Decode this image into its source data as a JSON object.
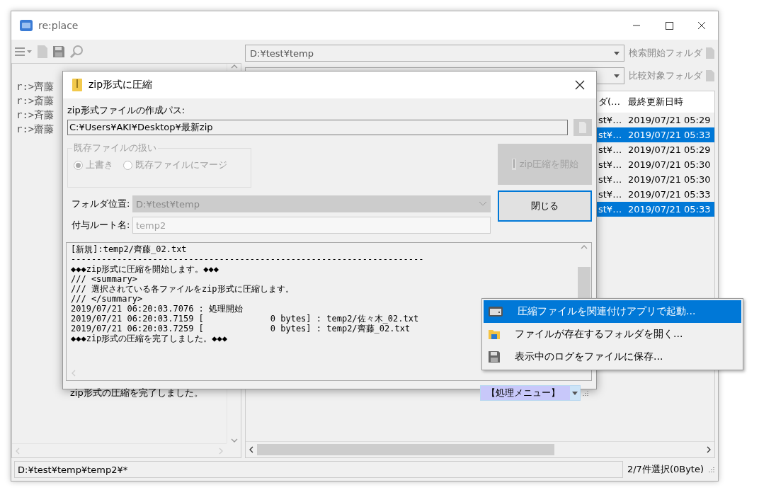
{
  "window": {
    "title": "re:place"
  },
  "left_pane": {
    "lines": [
      "r:>齊藤",
      "r:>斎藤",
      "r:>斉藤",
      "r:>齋藤"
    ]
  },
  "folders": [
    {
      "value": "D:¥test¥temp",
      "button": "検索開始フォルダ"
    },
    {
      "button": "比較対象フォルダ"
    }
  ],
  "table": {
    "columns": [
      "ダ(…",
      "最終更新日時"
    ],
    "rows": [
      {
        "cells": [
          "st¥…",
          "2019/07/21 05:29"
        ],
        "selected": false
      },
      {
        "cells": [
          "st¥…",
          "2019/07/21 05:33"
        ],
        "selected": true
      },
      {
        "cells": [
          "st¥…",
          "2019/07/21 05:29"
        ],
        "selected": false
      },
      {
        "cells": [
          "st¥…",
          "2019/07/21 05:30"
        ],
        "selected": false
      },
      {
        "cells": [
          "st¥…",
          "2019/07/21 05:30"
        ],
        "selected": false
      },
      {
        "cells": [
          "st¥…",
          "2019/07/21 05:33"
        ],
        "selected": false
      },
      {
        "cells": [
          "st¥…",
          "2019/07/21 05:33"
        ],
        "selected": true
      }
    ]
  },
  "status_bar": {
    "path": "D:¥test¥temp¥temp2¥*",
    "selection": "2/7件選択(0Byte)"
  },
  "dialog": {
    "title": "zip形式に圧縮",
    "path_label": "zip形式ファイルの作成パス:",
    "path": "C:¥Users¥AKI¥Desktop¥最新zip",
    "existing_group": {
      "title": "既存ファイルの扱い",
      "disabled": true,
      "options": [
        {
          "label": "上書き",
          "selected": true
        },
        {
          "label": "既存ファイルにマージ",
          "selected": false
        }
      ]
    },
    "start_button": {
      "label": "zip圧縮を開始",
      "disabled": true
    },
    "folder_label": "フォルダ位置:",
    "folder": {
      "value": "D:¥test¥temp",
      "disabled": true
    },
    "root_label": "付与ルート名:",
    "root": {
      "value": "temp2",
      "disabled": true
    },
    "close_button": {
      "label": "閉じる",
      "focused": true
    },
    "log": [
      "[新規]:temp2/齊藤_02.txt",
      "---------------------------------------------------------------------",
      "◆◆◆zip形式に圧縮を開始します。◆◆◆",
      "/// <summary>",
      "/// 選択されている各ファイルをzip形式に圧縮します。",
      "/// </summary>",
      "2019/07/21 06:20:03.7076 : 処理開始",
      "2019/07/21 06:20:03.7159 [             0 bytes] : temp2/佐々木_02.txt",
      "2019/07/21 06:20:03.7259 [             0 bytes] : temp2/齊藤_02.txt",
      "◆◆◆zip形式の圧縮を完了しました。◆◆◆"
    ],
    "status": "zip形式の圧縮を完了しました。",
    "menu_button": "【処理メニュー】"
  },
  "menu": {
    "items": [
      {
        "kind": "archive",
        "label": "圧縮ファイルを関連付けアプリで起動...",
        "selected": true
      },
      {
        "kind": "folder",
        "label": "ファイルが存在するフォルダを開く...",
        "selected": false
      },
      {
        "kind": "save",
        "label": "表示中のログをファイルに保存...",
        "selected": false
      }
    ]
  }
}
